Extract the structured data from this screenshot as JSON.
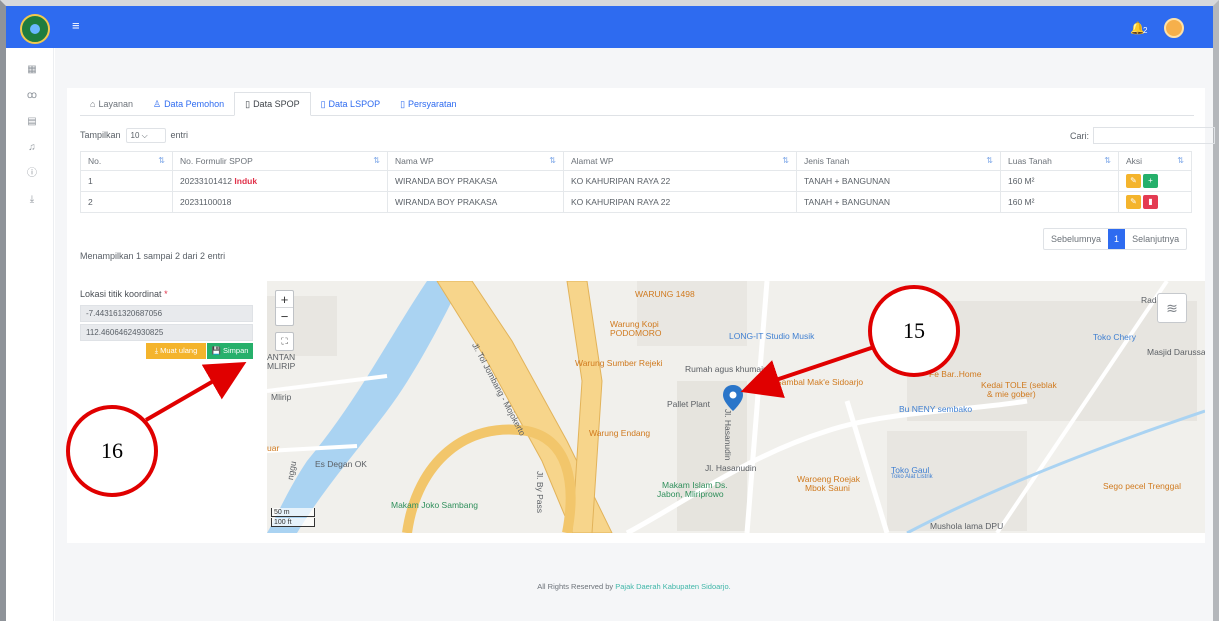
{
  "topbar": {
    "menu_icon": "hamburger-icon",
    "notification_icon": "bell-icon",
    "notification_count": "2"
  },
  "sidebar": {
    "items": [
      {
        "icon": "dashboard-icon"
      },
      {
        "icon": "users-icon"
      },
      {
        "icon": "document-icon"
      },
      {
        "icon": "bell-icon"
      },
      {
        "icon": "info-icon"
      },
      {
        "icon": "download-icon"
      }
    ]
  },
  "tabs": [
    {
      "label": "Layanan",
      "icon": "home-icon"
    },
    {
      "label": "Data Pemohon",
      "icon": "user-icon"
    },
    {
      "label": "Data SPOP",
      "icon": "document-icon"
    },
    {
      "label": "Data LSPOP",
      "icon": "file-icon"
    },
    {
      "label": "Persyaratan",
      "icon": "files-icon"
    }
  ],
  "table_controls": {
    "show_label": "Tampilkan",
    "page_length": "10",
    "entries_label": "entri",
    "search_label": "Cari:"
  },
  "table": {
    "columns": [
      "No.",
      "No. Formulir SPOP",
      "Nama WP",
      "Alamat WP",
      "Jenis Tanah",
      "Luas Tanah",
      "Aksi"
    ],
    "rows": [
      {
        "no": "1",
        "formulir": "20233101412",
        "badge": "Induk",
        "nama": "WIRANDA BOY PRAKASA",
        "alamat": "KO KAHURIPAN RAYA 22",
        "jenis": "TANAH + BANGUNAN",
        "luas": "160 M²"
      },
      {
        "no": "2",
        "formulir": "20231100018",
        "badge": "",
        "nama": "WIRANDA BOY PRAKASA",
        "alamat": "KO KAHURIPAN RAYA 22",
        "jenis": "TANAH + BANGUNAN",
        "luas": "160 M²"
      }
    ]
  },
  "pagination": {
    "info": "Menampilkan 1 sampai 2 dari 2 entri",
    "prev": "Sebelumnya",
    "current": "1",
    "next": "Selanjutnya"
  },
  "coordinates": {
    "label": "Lokasi titik koordinat",
    "required_mark": "*",
    "latitude": "-7.443161320687056",
    "longitude": "112.46064624930825",
    "reload_label": "Muat ulang",
    "save_label": "Simpan"
  },
  "map": {
    "labels": [
      {
        "text": "WARUNG 1498",
        "color": "orange"
      },
      {
        "text": "Warung Kopi",
        "color": "orange"
      },
      {
        "text": "PODOMORO",
        "color": "orange"
      },
      {
        "text": "LONG-IT Studio Musik",
        "color": "blue"
      },
      {
        "text": "Toko Chery",
        "color": "blue"
      },
      {
        "text": "Masjid Darussa",
        "color": "gray"
      },
      {
        "text": "Warung Sumber Rejeki",
        "color": "orange"
      },
      {
        "text": "Rumah agus khumairoh",
        "color": "gray"
      },
      {
        "text": "Sambal Mak'e Sidoarjo",
        "color": "orange"
      },
      {
        "text": "Fe Bar..Home",
        "color": "orange"
      },
      {
        "text": "Kedai TOLE (seblak",
        "color": "orange"
      },
      {
        "text": "& mie gober)",
        "color": "orange"
      },
      {
        "text": "Pallet Plant",
        "color": "gray"
      },
      {
        "text": "Bu NENY sembako",
        "color": "blue"
      },
      {
        "text": "Warung Endang",
        "color": "orange"
      },
      {
        "text": "Jl. Hasanudin",
        "color": "gray"
      },
      {
        "text": "Jl. Hasanudin",
        "color": "gray"
      },
      {
        "text": "Toko Gaul",
        "color": "blue"
      },
      {
        "text": "Toko Alat Listrik",
        "color": "blue"
      },
      {
        "text": "Waroeng Roejak",
        "color": "orange"
      },
      {
        "text": "Mbok Sauni",
        "color": "orange"
      },
      {
        "text": "Sego pecel Trenggal",
        "color": "orange"
      },
      {
        "text": "Makam Islam Ds.",
        "color": "green"
      },
      {
        "text": "Jabon, Mliriprowo",
        "color": "green"
      },
      {
        "text": "Es Degan OK",
        "color": "gray"
      },
      {
        "text": "Makam Joko Sambang",
        "color": "green"
      },
      {
        "text": "Mlirip",
        "color": "gray"
      },
      {
        "text": "ANTAN",
        "color": "gray"
      },
      {
        "text": "MLIRIP",
        "color": "gray"
      },
      {
        "text": "Mushola lama DPU",
        "color": "gray"
      },
      {
        "text": "Rad",
        "color": "gray"
      },
      {
        "text": "uar",
        "color": "orange"
      },
      {
        "text": "Jl. Tol Jombang - Mojokerto",
        "color": "gray"
      },
      {
        "text": "Jl. By Pass",
        "color": "gray"
      },
      {
        "text": "nggu",
        "color": "gray"
      }
    ],
    "scale_metric": "50 m",
    "scale_imperial": "100 ft",
    "zoom_in": "+",
    "zoom_out": "−"
  },
  "annotations": {
    "callout_15": "15",
    "callout_16": "16"
  },
  "footer": {
    "text": "All Rights Reserved by",
    "link": "Pajak Daerah Kabupaten Sidoarjo."
  },
  "colors": {
    "primary": "#2e6bf0",
    "warning": "#f4b42c",
    "success": "#26b06b",
    "danger": "#e43b52",
    "annotation": "#e00000"
  }
}
